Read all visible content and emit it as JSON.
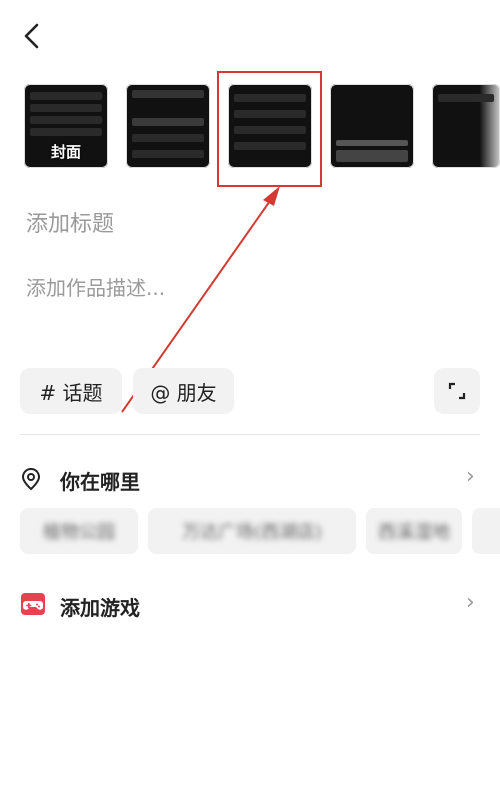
{
  "header": {
    "back_icon": "chevron-left-icon"
  },
  "media": {
    "cover_label": "封面",
    "thumbnails": [
      "settings-screen-1",
      "settings-screen-2",
      "settings-screen-3",
      "keyboard-screen",
      "partial-screen"
    ]
  },
  "form": {
    "title_placeholder": "添加标题",
    "desc_placeholder": "添加作品描述..."
  },
  "tags": {
    "topic_label": "# 话题",
    "friend_label": "@ 朋友",
    "expand_icon": "expand-icon"
  },
  "location": {
    "label": "你在哪里",
    "icon": "location-pin-icon",
    "suggestions": [
      "植物公园",
      "万达广场(西湖店)",
      "西溪湿地"
    ]
  },
  "game": {
    "label": "添加游戏",
    "icon": "gamepad-icon"
  },
  "colors": {
    "annotation": "#d33a32",
    "game_icon": "#e6424f"
  }
}
